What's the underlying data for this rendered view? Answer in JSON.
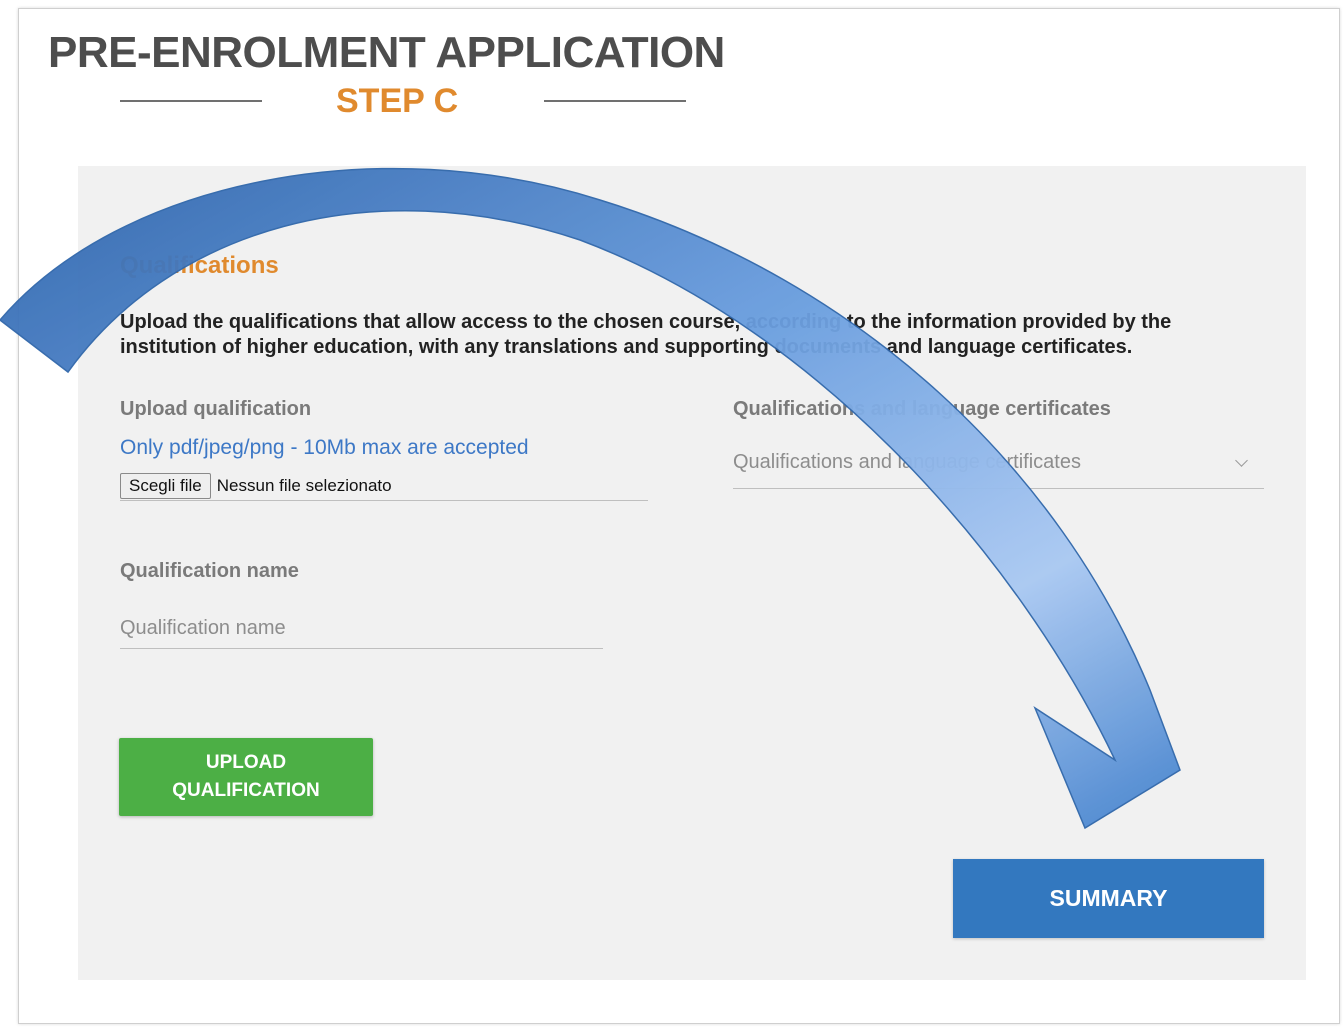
{
  "header": {
    "title": "PRE-ENROLMENT APPLICATION",
    "step": "STEP C"
  },
  "section": {
    "title": "Qualifications",
    "description": "Upload the qualifications that allow access to the chosen course, according to the information provided by the institution of higher education, with any translations and supporting documents and language certificates."
  },
  "upload": {
    "label": "Upload qualification",
    "hint": "Only pdf/jpeg/png - 10Mb max are accepted",
    "choose_button": "Scegli file",
    "no_file_text": "Nessun file selezionato"
  },
  "type_select": {
    "label": "Qualifications and language certificates",
    "value": "Qualifications and language certificates"
  },
  "name_field": {
    "label": "Qualification name",
    "placeholder": "Qualification name"
  },
  "buttons": {
    "upload": "UPLOAD\nQUALIFICATION",
    "summary": "SUMMARY"
  },
  "colors": {
    "accent_orange": "#e08a2e",
    "link_blue": "#3d78c6",
    "upload_green": "#4caf45",
    "summary_blue": "#3378bf",
    "arrow_blue": "#3f7fcc"
  },
  "icons": {
    "dropdown": "chevron-down-icon",
    "overlay": "curved-arrow-icon"
  }
}
